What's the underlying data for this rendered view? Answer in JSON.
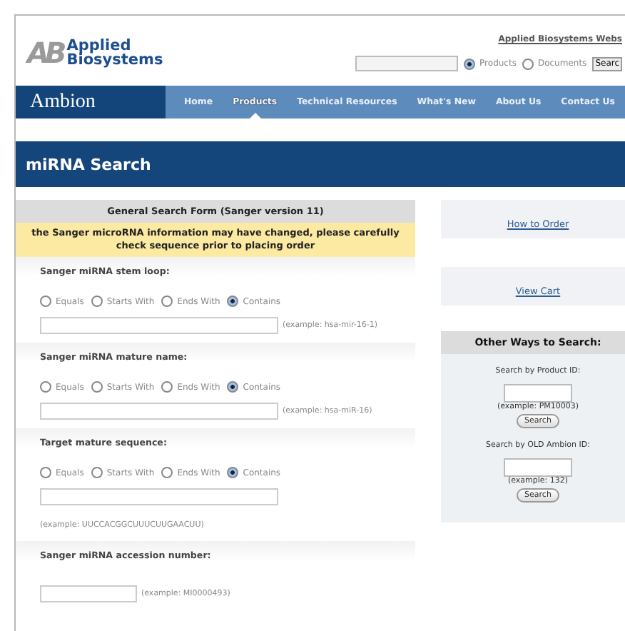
{
  "header": {
    "logo": {
      "mark": "AB",
      "line1": "Applied",
      "line2": "Biosystems"
    },
    "website_link": "Applied Biosystems Webs",
    "scope_options": [
      {
        "label": "Products",
        "selected": true
      },
      {
        "label": "Documents",
        "selected": false
      }
    ],
    "search_button": "Searc"
  },
  "nav": {
    "brand": "Ambion",
    "items": [
      {
        "label": "Home",
        "selected": false
      },
      {
        "label": "Products",
        "selected": true
      },
      {
        "label": "Technical Resources",
        "selected": false
      },
      {
        "label": "What's New",
        "selected": false
      },
      {
        "label": "About Us",
        "selected": false
      },
      {
        "label": "Contact Us",
        "selected": false
      }
    ]
  },
  "page_title": "miRNA Search",
  "form": {
    "title": "General Search Form (Sanger version 11)",
    "notice": "the Sanger microRNA information may have changed, please carefully check sequence prior to placing order",
    "sections": [
      {
        "label": "Sanger miRNA stem loop:",
        "options": [
          {
            "label": "Equals",
            "selected": false
          },
          {
            "label": "Starts With",
            "selected": false
          },
          {
            "label": "Ends With",
            "selected": false
          },
          {
            "label": "Contains",
            "selected": true
          }
        ],
        "example": "(example: hsa-mir-16-1)",
        "kind": "inline"
      },
      {
        "label": "Sanger miRNA mature name:",
        "options": [
          {
            "label": "Equals",
            "selected": false
          },
          {
            "label": "Starts With",
            "selected": false
          },
          {
            "label": "Ends With",
            "selected": false
          },
          {
            "label": "Contains",
            "selected": true
          }
        ],
        "example": "(example: hsa-miR-16)",
        "kind": "inline"
      },
      {
        "label": "Target mature sequence:",
        "options": [
          {
            "label": "Equals",
            "selected": false
          },
          {
            "label": "Starts With",
            "selected": false
          },
          {
            "label": "Ends With",
            "selected": false
          },
          {
            "label": "Contains",
            "selected": true
          }
        ],
        "example": "(example: UUCCACGGCUUUCUUGAACUU)",
        "kind": "stacked"
      },
      {
        "label": "Sanger miRNA accession number:",
        "example": "(example: MI0000493)",
        "kind": "short"
      }
    ]
  },
  "sidebar": {
    "links": [
      "How to Order",
      "View Cart"
    ],
    "other_search": {
      "title": "Other Ways to Search:",
      "groups": [
        {
          "label": "Search by Product ID:",
          "example": "(example: PM10003)",
          "button": "Search"
        },
        {
          "label": "Search by OLD Ambion ID:",
          "example": "(example: 132)",
          "button": "Search"
        }
      ]
    }
  }
}
